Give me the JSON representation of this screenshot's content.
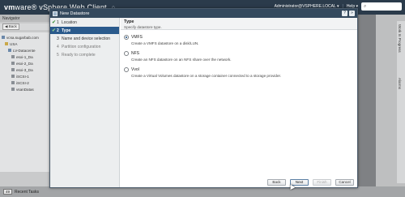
{
  "header": {
    "brand_vm": "vm",
    "brand_rest": "ware® vSphere Web Client",
    "home_icon": "home-icon",
    "user": "Administrator@VSPHERE.LOCAL ▾",
    "sep": "|",
    "help": "Help ▾",
    "search_placeholder": "⌕"
  },
  "navigator": {
    "title": "Navigator",
    "back": "◀ Back",
    "tree": [
      {
        "label": "vcsa.sugarbab.com"
      },
      {
        "label": "USA"
      },
      {
        "label": "LV-Datacente"
      },
      {
        "label": "esxi-1_Da"
      },
      {
        "label": "esxi-2_Da"
      },
      {
        "label": "esxi-3_Da"
      },
      {
        "label": "iSCSI-1"
      },
      {
        "label": "iSCSI-2"
      },
      {
        "label": "vsanDatas"
      }
    ]
  },
  "rightpane": {
    "tab1": "Work In Progress",
    "tab2": "Alarms"
  },
  "bottombar": {
    "count": "49",
    "label": "Recent Tasks"
  },
  "dialog": {
    "title": "New Datastore",
    "help_btn": "?",
    "close_btn": "»",
    "steps": [
      {
        "check": "✔",
        "num": "1",
        "label": "Location",
        "state": "done"
      },
      {
        "check": "✔",
        "num": "2",
        "label": "Type",
        "state": "active"
      },
      {
        "check": "",
        "num": "3",
        "label": "Name and device selection",
        "state": "normal"
      },
      {
        "check": "",
        "num": "4",
        "label": "Partition configuration",
        "state": "future"
      },
      {
        "check": "",
        "num": "5",
        "label": "Ready to complete",
        "state": "future"
      }
    ],
    "content_title": "Type",
    "content_subtitle": "Specify datastore type.",
    "options": [
      {
        "label": "VMFS",
        "desc": "Create a VMFS datastore on a disk/LUN.",
        "selected": true
      },
      {
        "label": "NFS",
        "desc": "Create an NFS datastore on an NFS share over the network.",
        "selected": false
      },
      {
        "label": "Vvol",
        "desc": "Create a Virtual Volumes datastore on a storage container connected to a storage provider.",
        "selected": false
      }
    ],
    "buttons": {
      "back": "Back",
      "next": "Next",
      "finish": "Finish",
      "cancel": "Cancel"
    }
  }
}
